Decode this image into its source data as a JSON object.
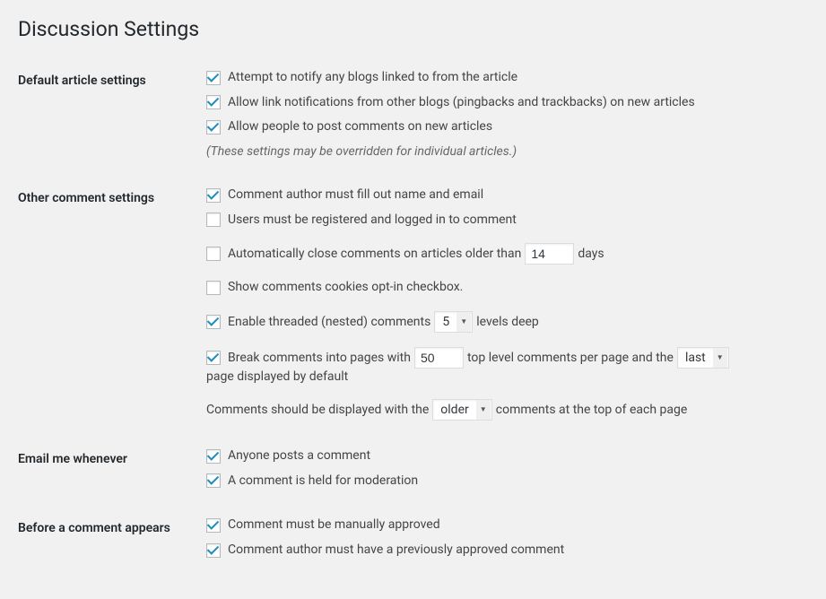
{
  "pageTitle": "Discussion Settings",
  "sections": {
    "defaultArticle": {
      "heading": "Default article settings",
      "notify": "Attempt to notify any blogs linked to from the article",
      "pingbacks": "Allow link notifications from other blogs (pingbacks and trackbacks) on new articles",
      "allowComments": "Allow people to post comments on new articles",
      "note": "(These settings may be overridden for individual articles.)"
    },
    "otherComment": {
      "heading": "Other comment settings",
      "requireNameEmail": "Comment author must fill out name and email",
      "requireRegistration": "Users must be registered and logged in to comment",
      "autoClose_before": "Automatically close comments on articles older than",
      "autoClose_after": "days",
      "autoClose_value": "14",
      "cookiesOptIn": "Show comments cookies opt-in checkbox.",
      "threaded_before": "Enable threaded (nested) comments",
      "threaded_after": "levels deep",
      "threaded_value": "5",
      "paginate_a": "Break comments into pages with",
      "paginate_value": "50",
      "paginate_b": "top level comments per page and the",
      "paginate_page": "last",
      "paginate_c": "page displayed by default",
      "order_a": "Comments should be displayed with the",
      "order_value": "older",
      "order_b": "comments at the top of each page"
    },
    "emailMe": {
      "heading": "Email me whenever",
      "anyonePosts": "Anyone posts a comment",
      "heldModeration": "A comment is held for moderation"
    },
    "beforeAppears": {
      "heading": "Before a comment appears",
      "manualApprove": "Comment must be manually approved",
      "prevApproved": "Comment author must have a previously approved comment"
    }
  }
}
